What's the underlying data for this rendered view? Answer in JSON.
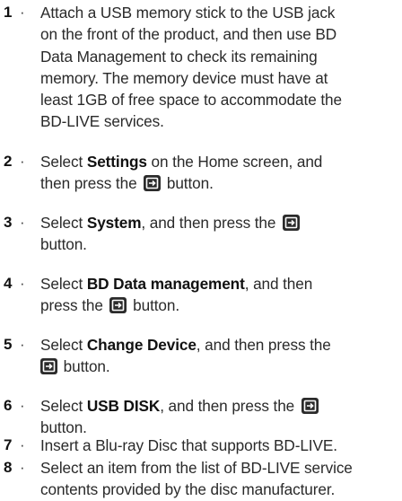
{
  "steps": [
    {
      "number": "1",
      "lines": [
        [
          "Attach a USB memory stick to the USB jack"
        ],
        [
          "on the front of the product, and then use BD"
        ],
        [
          "Data Management to check its remaining"
        ],
        [
          "memory. The memory device must have at"
        ],
        [
          "least 1GB of free space to accommodate the"
        ],
        [
          "BD-LIVE services."
        ]
      ]
    },
    {
      "number": "2",
      "pre": "Select ",
      "bold": "Settings",
      "post": " on the Home screen, and",
      "line2_pre": "then press the ",
      "line2_post": " button."
    },
    {
      "number": "3",
      "pre": "Select ",
      "bold": "System",
      "post": ", and then press the ",
      "line2": "button."
    },
    {
      "number": "4",
      "pre": "Select ",
      "bold": "BD Data management",
      "post": ", and then",
      "line2_pre": "press the ",
      "line2_post": " button."
    },
    {
      "number": "5",
      "pre": "Select ",
      "bold": "Change Device",
      "post": ", and then press the",
      "line2_post": " button."
    },
    {
      "number": "6",
      "pre": "Select ",
      "bold": "USB DISK",
      "post": ", and then press the ",
      "line2": "button."
    },
    {
      "number": "7",
      "text": "Insert a Blu-ray Disc that supports BD-LIVE."
    },
    {
      "number": "8",
      "line1": "Select an item from the list of BD-LIVE service",
      "line2": "contents provided by the disc manufacturer."
    }
  ],
  "separator": "·",
  "icon": "enter-icon"
}
